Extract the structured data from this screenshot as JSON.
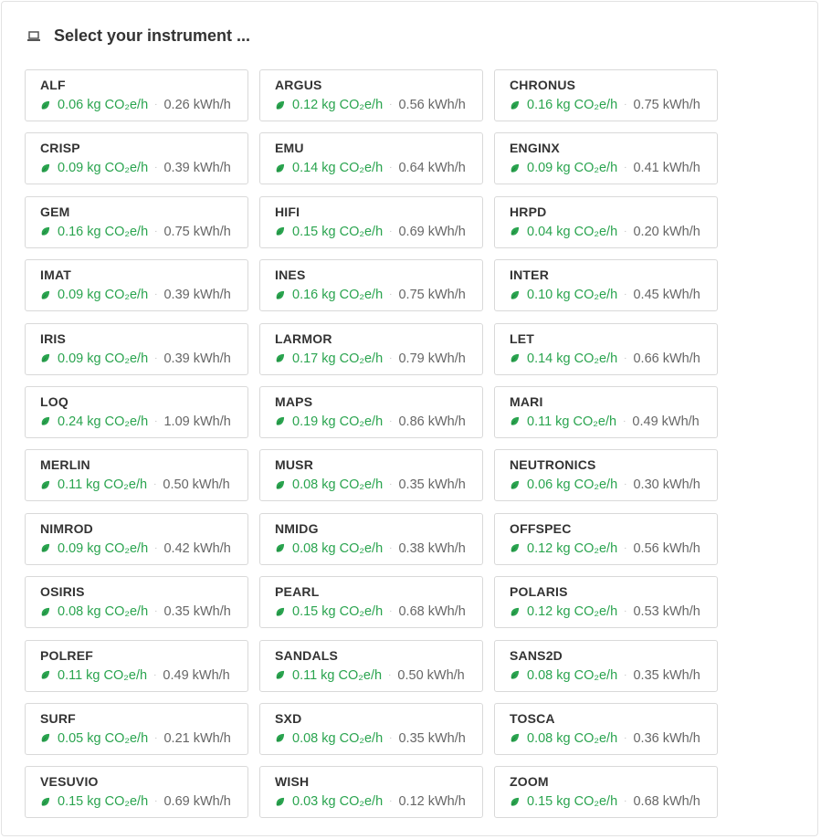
{
  "header": {
    "title": "Select your instrument ...",
    "icon": "laptop-icon"
  },
  "colors": {
    "co2": "#2aa44f",
    "kwh": "#666666",
    "border": "#d9d9d9"
  },
  "instruments": [
    {
      "name": "ALF",
      "co2": "0.06 kg CO₂e/h",
      "kwh": "0.26 kWh/h"
    },
    {
      "name": "ARGUS",
      "co2": "0.12 kg CO₂e/h",
      "kwh": "0.56 kWh/h"
    },
    {
      "name": "CHRONUS",
      "co2": "0.16 kg CO₂e/h",
      "kwh": "0.75 kWh/h"
    },
    {
      "name": "CRISP",
      "co2": "0.09 kg CO₂e/h",
      "kwh": "0.39 kWh/h"
    },
    {
      "name": "EMU",
      "co2": "0.14 kg CO₂e/h",
      "kwh": "0.64 kWh/h"
    },
    {
      "name": "ENGINX",
      "co2": "0.09 kg CO₂e/h",
      "kwh": "0.41 kWh/h"
    },
    {
      "name": "GEM",
      "co2": "0.16 kg CO₂e/h",
      "kwh": "0.75 kWh/h"
    },
    {
      "name": "HIFI",
      "co2": "0.15 kg CO₂e/h",
      "kwh": "0.69 kWh/h"
    },
    {
      "name": "HRPD",
      "co2": "0.04 kg CO₂e/h",
      "kwh": "0.20 kWh/h"
    },
    {
      "name": "IMAT",
      "co2": "0.09 kg CO₂e/h",
      "kwh": "0.39 kWh/h"
    },
    {
      "name": "INES",
      "co2": "0.16 kg CO₂e/h",
      "kwh": "0.75 kWh/h"
    },
    {
      "name": "INTER",
      "co2": "0.10 kg CO₂e/h",
      "kwh": "0.45 kWh/h"
    },
    {
      "name": "IRIS",
      "co2": "0.09 kg CO₂e/h",
      "kwh": "0.39 kWh/h"
    },
    {
      "name": "LARMOR",
      "co2": "0.17 kg CO₂e/h",
      "kwh": "0.79 kWh/h"
    },
    {
      "name": "LET",
      "co2": "0.14 kg CO₂e/h",
      "kwh": "0.66 kWh/h"
    },
    {
      "name": "LOQ",
      "co2": "0.24 kg CO₂e/h",
      "kwh": "1.09 kWh/h"
    },
    {
      "name": "MAPS",
      "co2": "0.19 kg CO₂e/h",
      "kwh": "0.86 kWh/h"
    },
    {
      "name": "MARI",
      "co2": "0.11 kg CO₂e/h",
      "kwh": "0.49 kWh/h"
    },
    {
      "name": "MERLIN",
      "co2": "0.11 kg CO₂e/h",
      "kwh": "0.50 kWh/h"
    },
    {
      "name": "MUSR",
      "co2": "0.08 kg CO₂e/h",
      "kwh": "0.35 kWh/h"
    },
    {
      "name": "NEUTRONICS",
      "co2": "0.06 kg CO₂e/h",
      "kwh": "0.30 kWh/h"
    },
    {
      "name": "NIMROD",
      "co2": "0.09 kg CO₂e/h",
      "kwh": "0.42 kWh/h"
    },
    {
      "name": "NMIDG",
      "co2": "0.08 kg CO₂e/h",
      "kwh": "0.38 kWh/h"
    },
    {
      "name": "OFFSPEC",
      "co2": "0.12 kg CO₂e/h",
      "kwh": "0.56 kWh/h"
    },
    {
      "name": "OSIRIS",
      "co2": "0.08 kg CO₂e/h",
      "kwh": "0.35 kWh/h"
    },
    {
      "name": "PEARL",
      "co2": "0.15 kg CO₂e/h",
      "kwh": "0.68 kWh/h"
    },
    {
      "name": "POLARIS",
      "co2": "0.12 kg CO₂e/h",
      "kwh": "0.53 kWh/h"
    },
    {
      "name": "POLREF",
      "co2": "0.11 kg CO₂e/h",
      "kwh": "0.49 kWh/h"
    },
    {
      "name": "SANDALS",
      "co2": "0.11 kg CO₂e/h",
      "kwh": "0.50 kWh/h"
    },
    {
      "name": "SANS2D",
      "co2": "0.08 kg CO₂e/h",
      "kwh": "0.35 kWh/h"
    },
    {
      "name": "SURF",
      "co2": "0.05 kg CO₂e/h",
      "kwh": "0.21 kWh/h"
    },
    {
      "name": "SXD",
      "co2": "0.08 kg CO₂e/h",
      "kwh": "0.35 kWh/h"
    },
    {
      "name": "TOSCA",
      "co2": "0.08 kg CO₂e/h",
      "kwh": "0.36 kWh/h"
    },
    {
      "name": "VESUVIO",
      "co2": "0.15 kg CO₂e/h",
      "kwh": "0.69 kWh/h"
    },
    {
      "name": "WISH",
      "co2": "0.03 kg CO₂e/h",
      "kwh": "0.12 kWh/h"
    },
    {
      "name": "ZOOM",
      "co2": "0.15 kg CO₂e/h",
      "kwh": "0.68 kWh/h"
    }
  ],
  "separator": "·"
}
